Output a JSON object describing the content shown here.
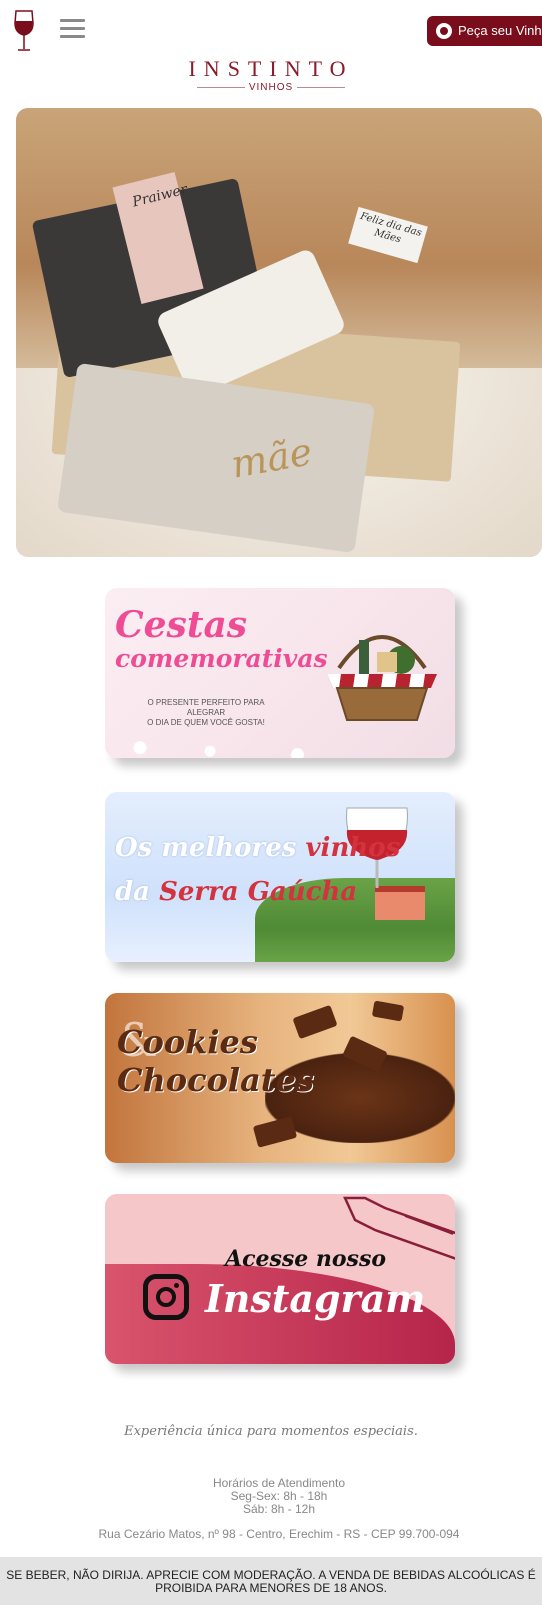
{
  "header": {
    "menu_icon": "hamburger-icon",
    "logo_icon": "wine-glass-logo-icon",
    "cta_label": "Peça seu Vinho",
    "cta_icon": "whatsapp-icon",
    "cta_color": "#7a0d1b"
  },
  "brand": {
    "name": "INSTINTO",
    "subtitle": "VINHOS",
    "color": "#8b1a2a"
  },
  "hero": {
    "tag_brand": "Praiwer",
    "card_text": "Feliz dia das Mães",
    "napkin_text": "mãe"
  },
  "banners": [
    {
      "title_line1": "Cestas",
      "title_line2": "comemorativas",
      "subtitle_line1": "O PRESENTE PERFEITO PARA ALEGRAR",
      "subtitle_line2": "O DIA DE QUEM VOCÊ GOSTA!",
      "accent": "#ee4d96"
    },
    {
      "title_line1_a": "Os melhores ",
      "title_line1_b": "vinhos",
      "title_line2_a": "da ",
      "title_line2_b": "Serra Gaúcha",
      "accent": "#d3333f"
    },
    {
      "title_line1": "Cookies",
      "title_line2": "Chocolates",
      "ampersand": "&"
    },
    {
      "label": "Acesse nosso",
      "title": "Instagram",
      "icon": "instagram-icon"
    }
  ],
  "footer": {
    "tagline": "Experiência única para momentos especiais.",
    "hours_title": "Horários de Atendimento",
    "hours_weekdays": "Seg-Sex: 8h - 18h",
    "hours_saturday": "Sáb: 8h - 12h",
    "address": "Rua Cezário Matos, nº 98 - Centro, Erechim - RS - CEP 99.700-094",
    "warning_line1": "SE BEBER, NÃO DIRIJA. APRECIE COM MODERAÇÃO. A VENDA DE BEBIDAS ALCOÓLICAS É",
    "warning_line2": "PROIBIDA PARA MENORES DE 18 ANOS."
  }
}
